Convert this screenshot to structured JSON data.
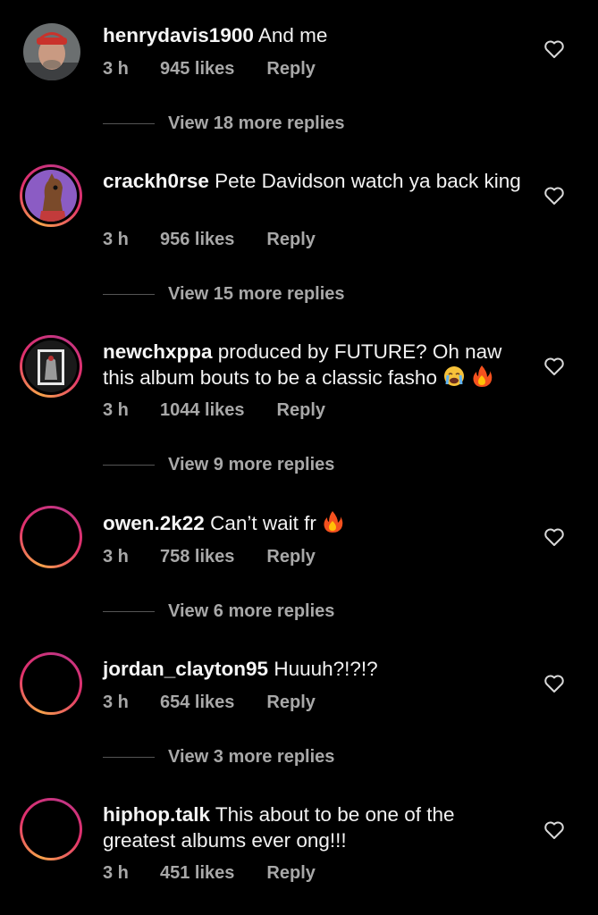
{
  "comments": [
    {
      "username": "henrydavis1900",
      "text": "And me",
      "time": "3 h",
      "likes": "945 likes",
      "reply": "Reply",
      "view_more": "View 18 more replies",
      "avatar": "photo"
    },
    {
      "username": "crackh0rse",
      "text": "Pete Davidson watch ya back king",
      "time": "3 h",
      "likes": "956 likes",
      "reply": "Reply",
      "view_more": "View 15 more replies",
      "avatar": "story-ring-horse"
    },
    {
      "username": "newchxppa",
      "text": "produced by FUTURE? Oh naw this album bouts to be a classic fasho",
      "emojis": [
        "crying-face-emoji",
        "fire-emoji"
      ],
      "time": "3 h",
      "likes": "1044 likes",
      "reply": "Reply",
      "view_more": "View 9 more replies",
      "avatar": "story-ring-album"
    },
    {
      "username": "owen.2k22",
      "text": "Can’t wait fr",
      "emojis": [
        "fire-emoji"
      ],
      "time": "3 h",
      "likes": "758 likes",
      "reply": "Reply",
      "view_more": "View 6 more replies",
      "avatar": "story-ring-empty"
    },
    {
      "username": "jordan_clayton95",
      "text": "Huuuh?!?!?",
      "time": "3 h",
      "likes": "654 likes",
      "reply": "Reply",
      "view_more": "View 3 more replies",
      "avatar": "story-ring-empty"
    },
    {
      "username": "hiphop.talk",
      "text": "This about to be one of the greatest albums ever ong!!!",
      "time": "3 h",
      "likes": "451 likes",
      "reply": "Reply",
      "avatar": "story-ring-empty"
    }
  ],
  "colors": {
    "background": "#000000",
    "text": "#f2f2f2",
    "meta": "#a8a8a8",
    "ring_start": "#f7a34b",
    "ring_end": "#e1306c"
  }
}
